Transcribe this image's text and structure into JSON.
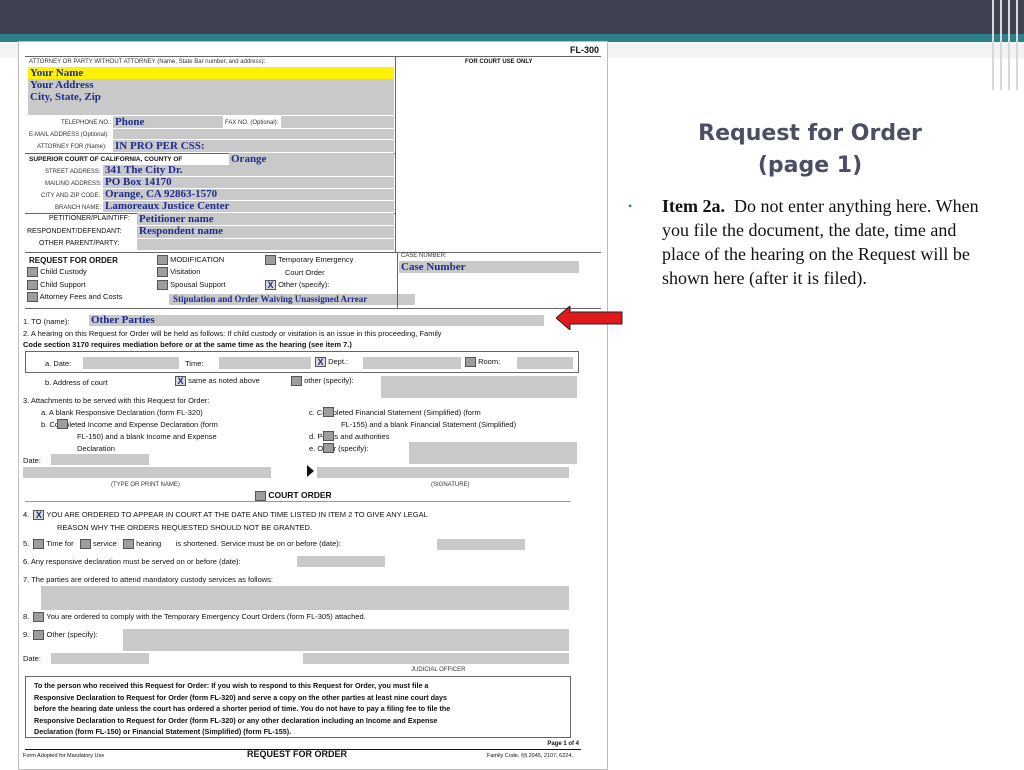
{
  "slide": {
    "title_line1": "Request for Order",
    "title_line2": "(page 1)",
    "bullet_bold": "Item 2a.",
    "bullet_text": "Do not enter anything here.  When you file the document, the date, time and place of the hearing on the Request will be shown here (after it is filed).",
    "colors": {
      "header": "#3f4150",
      "accent": "#2f7f86",
      "title": "#4a4f63",
      "arrow": "#e0191d",
      "highlight": "#fff200",
      "field_shade": "#c9c9c9",
      "filled_text": "#1f2b8c"
    }
  },
  "form": {
    "code": "FL-300",
    "attorney_header": "ATTORNEY OR PARTY WITHOUT ATTORNEY (Name, State Bar number, and address):",
    "court_use": "FOR COURT USE ONLY",
    "your_name": "Your Name",
    "your_address": "Your Address",
    "city_state_zip": "City, State, Zip",
    "telephone_label": "TELEPHONE NO.:",
    "phone": "Phone",
    "fax_label": "FAX NO. (Optional):",
    "email_label": "E-MAIL ADDRESS (Optional):",
    "attorney_for_label": "ATTORNEY FOR (Name):",
    "attorney_for": "IN PRO PER     CSS:",
    "superior_court": "SUPERIOR COURT OF CALIFORNIA, COUNTY OF",
    "county": "Orange",
    "street_label": "STREET ADDRESS:",
    "street": "341 The City Dr.",
    "mailing_label": "MAILING ADDRESS:",
    "mailing": "PO Box 14170",
    "city_label": "CITY AND ZIP CODE:",
    "city": "Orange, CA  92863-1570",
    "branch_label": "BRANCH NAME:",
    "branch": "Lamoreaux Justice Center",
    "petitioner_label": "PETITIONER/PLAINTIFF:",
    "petitioner": "Petitioner name",
    "respondent_label": "RESPONDENT/DEFENDANT:",
    "respondent": "Respondent name",
    "other_parent_label": "OTHER PARENT/PARTY:",
    "request_title": "REQUEST FOR ORDER",
    "child_custody": "Child Custody",
    "child_support": "Child Support",
    "attorney_fees": "Attorney Fees and Costs",
    "modification": "MODIFICATION",
    "visitation": "Visitation",
    "spousal_support": "Spousal Support",
    "temp_emergency": "Temporary Emergency",
    "court_order": "Court Order",
    "other_specify": "Other (specify):",
    "other_value": "Stipulation and Order Waiving Unassigned Arrear",
    "case_number_label": "CASE NUMBER:",
    "case_number": "Case Number",
    "item1_label": "1.    TO (name):",
    "item1_value": "Other Parties",
    "item2_text": "2.    A hearing on this Request for Order will be held as follows: If child custody or visitation is an issue in this proceeding, Family",
    "item2_text2": "Code section 3170 requires mediation before or at the same time as the hearing (see item 7.)",
    "date_label": "a.  Date:",
    "time_label": "Time:",
    "dept_label": "Dept.:",
    "room_label": "Room:",
    "address_label": "b.  Address of court",
    "same_as_above": "same as noted above",
    "other_specify2": "other (specify):",
    "item3": "3.    Attachments to be served with this Request for Order:",
    "item3a": "a.    A blank Responsive Declaration (form FL-320)",
    "item3b1": "b.         Completed Income and Expense Declaration (form",
    "item3b2": "FL-150) and a blank Income and Expense",
    "item3b3": "Declaration",
    "item3c1": "c.         Completed Financial Statement (Simplified) (form",
    "item3c2": "FL-155) and a blank Financial Statement (Simplified)",
    "item3d": "d.         Points and authorities",
    "item3e": "e.         Other (specify):",
    "date_label2": "Date:",
    "type_or_print": "(TYPE OR PRINT NAME)",
    "signature": "(SIGNATURE)",
    "court_order_title": "COURT ORDER",
    "item4_1": "YOU ARE ORDERED TO APPEAR IN COURT AT THE DATE AND TIME LISTED IN ITEM 2 TO GIVE ANY LEGAL",
    "item4_2": "REASON WHY THE ORDERS REQUESTED SHOULD NOT BE GRANTED.",
    "item5_time": "Time for",
    "item5_service": "service",
    "item5_hearing": "hearing",
    "item5_rest": "is shortened. Service must be on or before (date):",
    "item6": "6.    Any responsive declaration must be served on or before (date):",
    "item7": "7.    The parties are ordered to attend mandatory custody services as follows:",
    "item8": "You are ordered to comply with the Temporary Emergency Court Orders (form FL-305) attached.",
    "item9": "Other (specify):",
    "judicial_officer": "JUDICIAL OFFICER",
    "notice1": "To the person who received this Request for Order: If you wish to respond to this Request for Order, you must file a",
    "notice2": "Responsive Declaration to Request for Order (form FL-320) and serve a copy on the other parties at least nine court days",
    "notice3": "before the hearing date unless the court has ordered a shorter period of time. You do not have to pay a filing fee to file the",
    "notice4": "Responsive Declaration to Request for Order (form FL-320) or any other declaration including an Income and Expense",
    "notice5": "Declaration (form FL-150) or Financial Statement (Simplified) (form FL-155).",
    "page_of": "Page 1 of 4",
    "footer_left": "Form Adopted for Mandatory Use",
    "footer_title": "REQUEST FOR ORDER",
    "footer_right": "Family Code, §§ 2045, 2107, 6224,"
  }
}
